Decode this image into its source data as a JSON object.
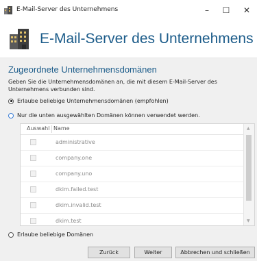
{
  "window": {
    "title": "E-Mail-Server des Unternehmens",
    "minimize_glyph": "–",
    "maximize_glyph": "☐",
    "close_glyph": "✕"
  },
  "header": {
    "title": "E-Mail-Server des Unternehmens",
    "icon": "server-building-icon"
  },
  "section": {
    "title": "Zugeordnete Unternehmensdomänen",
    "description": "Geben Sie die Unternehmensdomänen an, die mit diesem E-Mail-Server des Unternehmens verbunden sind."
  },
  "options": {
    "allow_any_enterprise": "Erlaube beliebige Unternehmensdomänen (empfohlen)",
    "only_selected": "Nur die unten ausgewählten Domänen können verwendet werden.",
    "allow_any_domain": "Erlaube beliebige Domänen",
    "selected": "allow_any_enterprise"
  },
  "domain_list": {
    "columns": [
      "Auswahl",
      "Name"
    ],
    "rows": [
      {
        "name": "administrative",
        "checked": false
      },
      {
        "name": "company.one",
        "checked": false
      },
      {
        "name": "company.uno",
        "checked": false
      },
      {
        "name": "dkim.failed.test",
        "checked": false
      },
      {
        "name": "dkim.invalid.test",
        "checked": false
      },
      {
        "name": "dkim.test",
        "checked": false
      }
    ]
  },
  "buttons": {
    "back": "Zurück",
    "next": "Weiter",
    "cancel": "Abbrechen und schließen"
  },
  "colors": {
    "accent": "#1c5c8a",
    "radio_accent": "#3b7ed6"
  }
}
